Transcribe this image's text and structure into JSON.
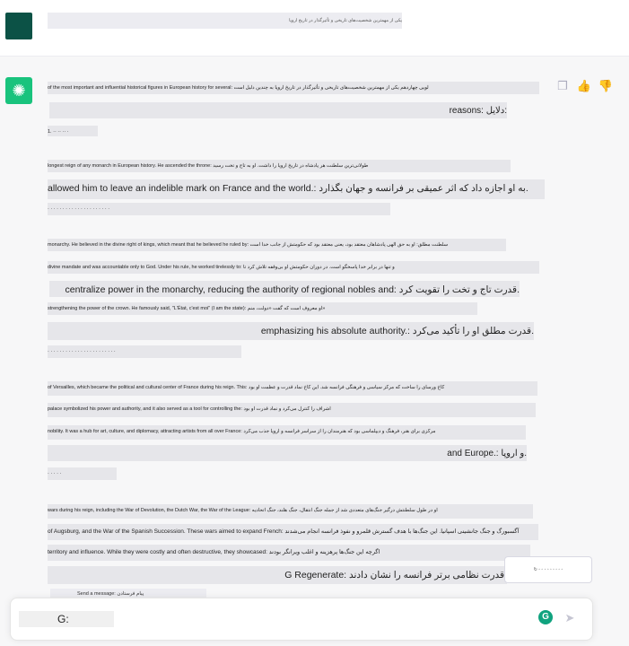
{
  "user_message": {
    "text": "یکی از مهمترین شخصیت‌های تاریخی و تأثیرگذار در تاریخ اروپا"
  },
  "assistant": {
    "avatar_glyph": "✺",
    "lines": [
      "of the most important and influential historical figures in European history for several: لویی چهاردهم یکی از مهمترین شخصیت‌های تاریخی و تأثیرگذار در تاریخ اروپا به چندین دلیل است",
      "reasons: دلایل:",
      "1. ·· ·· ·· ·",
      "longest reign of any monarch in European history. He ascended the throne: طولانی‌ترین سلطنت هر پادشاه در تاریخ اروپا را داشت. او به تاج و تخت رسید",
      "allowed him to leave an indelible mark on France and the world.: به او اجازه داد که اثر عمیقی بر فرانسه و جهان بگذارد.",
      "· · · · · · · · · · · · · · · · · · · · ·",
      "monarchy. He believed in the divine right of kings, which meant that he believed he ruled by: سلطنت مطلق: او به حق الهی پادشاهان معتقد بود، یعنی معتقد بود که حکومتش از جانب خدا است",
      "divine mandate and was accountable only to God. Under his rule, he worked tirelessly to: و تنها در برابر خدا پاسخگو است. در دوران حکومتش او بی‌وقفه تلاش کرد تا",
      "centralize power in the monarchy, reducing the authority of regional nobles and: قدرت تاج و تخت را تقویت کرد.",
      "strengthening the power of the crown. He famously said, \"L'État, c'est moi\" (I am the state): او معروف است که گفت «دولت، منم»",
      "emphasizing his absolute authority.: قدرت مطلق او را تأکید می‌کرد.",
      "· · · · · · · · · · · · · · · · · · · · · · ·",
      "of Versailles, which became the political and cultural center of France during his reign. This: کاخ ورسای را ساخت که مرکز سیاسی و فرهنگی فرانسه شد. این کاخ نماد قدرت و عظمت او بود",
      "palace symbolized his power and authority, and it also served as a tool for controlling the: اشراف را کنترل می‌کرد و نماد قدرت او بود",
      "nobility. It was a hub for art, culture, and diplomacy, attracting artists from all over France: مرکزی برای هنر، فرهنگ و دیپلماسی بود که هنرمندان را از سراسر فرانسه و اروپا جذب می‌کرد",
      "and Europe.: و اروپا.",
      "· · · · ·",
      "wars during his reign, including the War of Devolution, the Dutch War, the War of the League: او در طول سلطنتش درگیر جنگ‌های متعددی شد از جمله جنگ انتقال، جنگ هلند، جنگ اتحادیه",
      "of Augsburg, and the War of the Spanish Succession. These wars aimed to expand French: آگسبورگ و جنگ جانشینی اسپانیا. این جنگ‌ها با هدف گسترش قلمرو و نفوذ فرانسه انجام می‌شدند",
      "territory and influence. While they were costly and often destructive, they showcased: اگرچه این جنگ‌ها پرهزینه و اغلب ویرانگر بودند",
      "G Regenerate: قدرت نظامی برتر فرانسه را نشان دادند."
    ]
  },
  "actions": {
    "copy_icon": "clipboard-icon",
    "up_icon": "thumbs-up-icon",
    "down_icon": "thumbs-down-icon",
    "copy_glyph": "❐",
    "up_glyph": "👍",
    "down_glyph": "👎"
  },
  "regenerate_label": "↻ ◦ ◦ ◦ ◦ ◦ ◦ ◦ ◦ ◦",
  "composer": {
    "label": "Send a message: پیام فرستادن",
    "placeholder": "G:",
    "badge": "G",
    "send_glyph": "➤"
  }
}
